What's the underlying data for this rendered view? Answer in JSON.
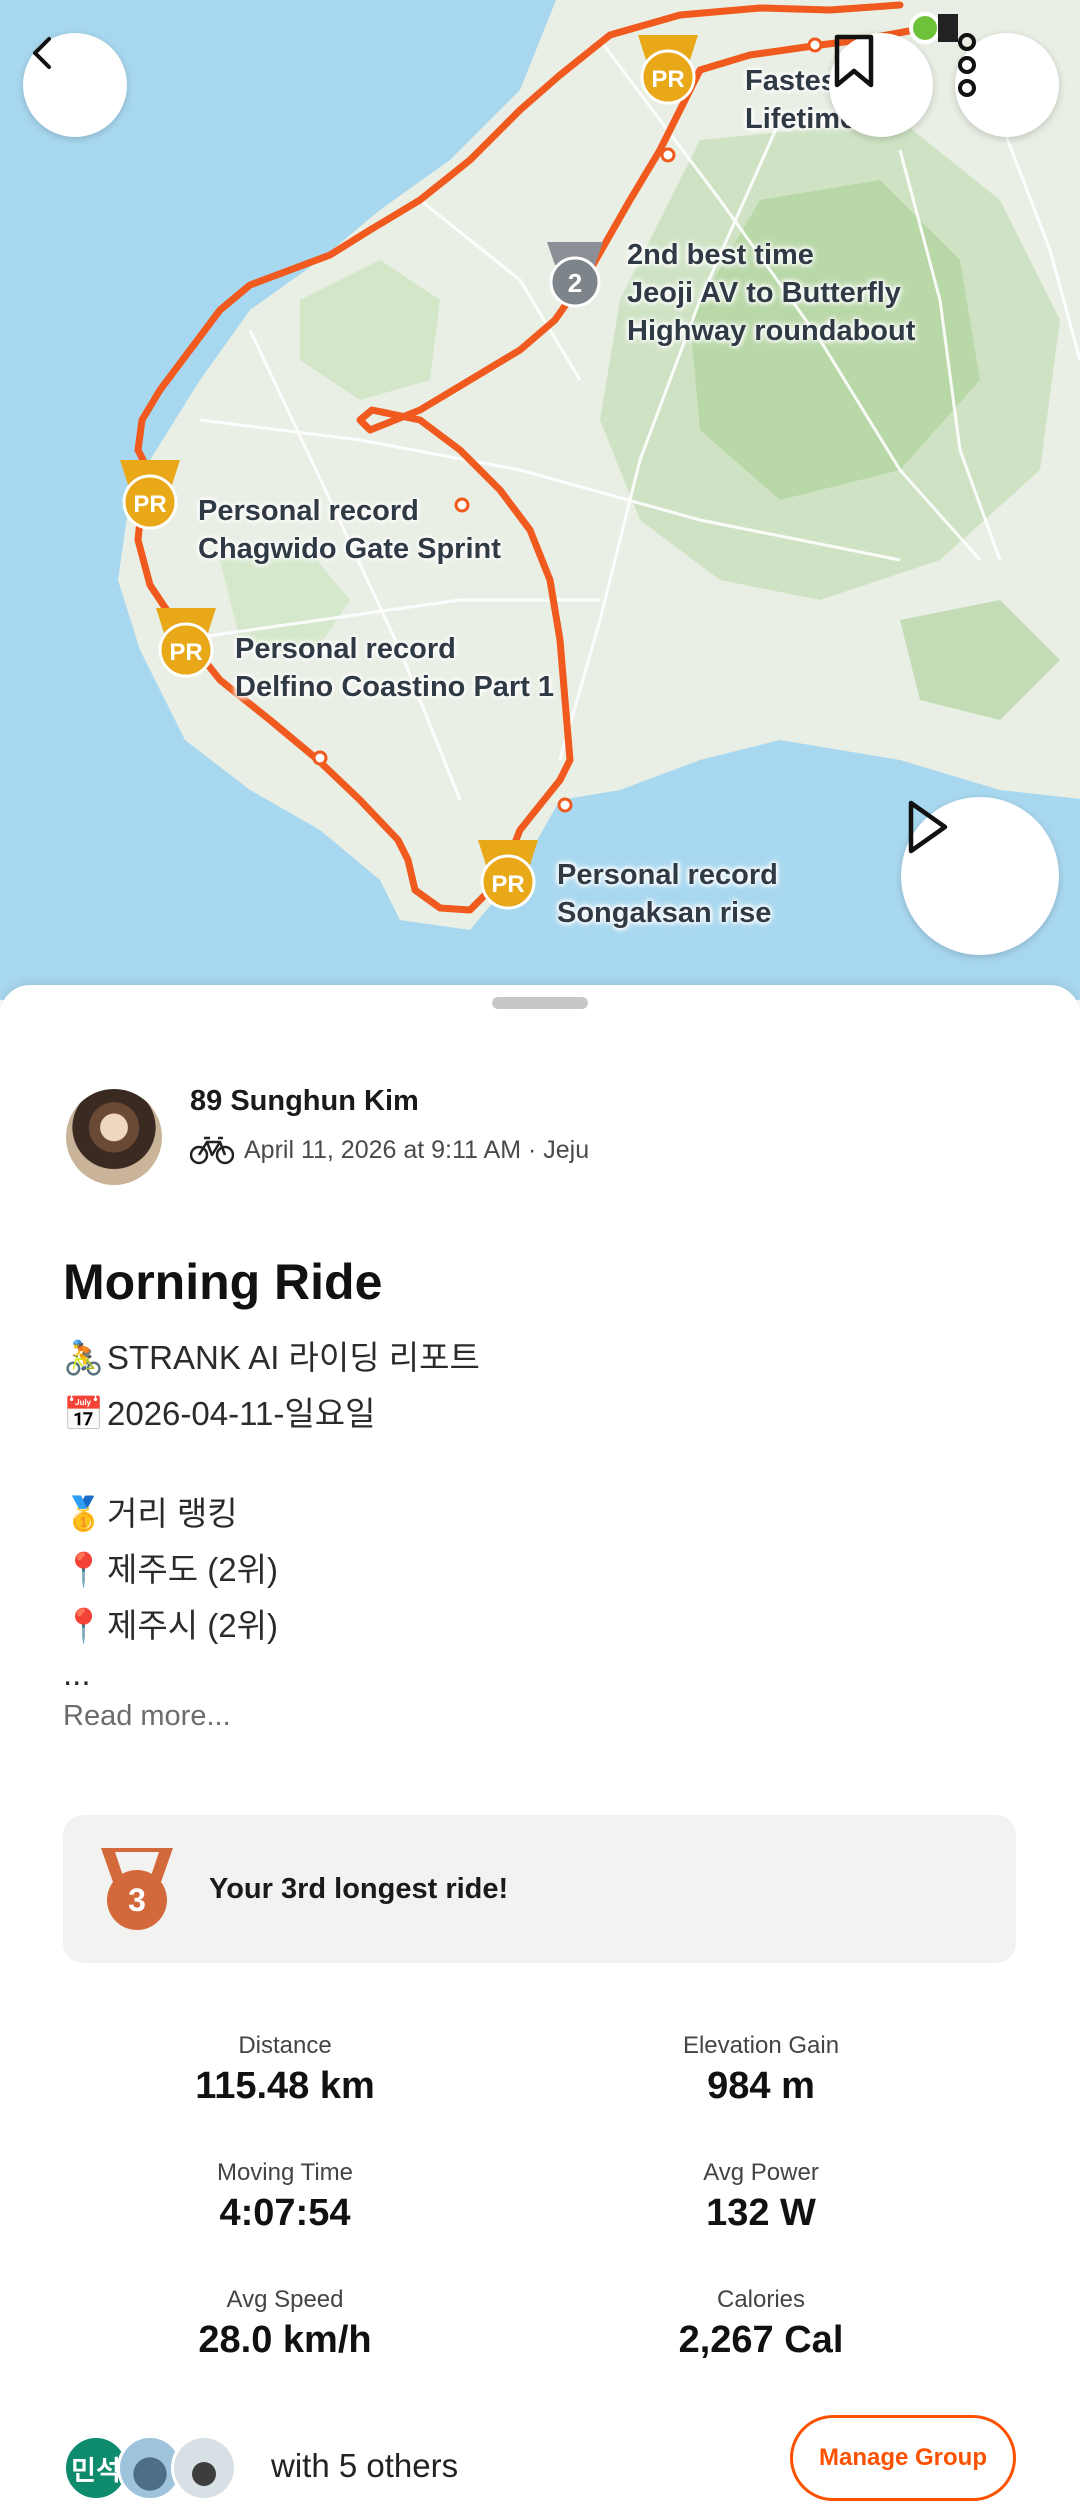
{
  "map": {
    "segments": [
      {
        "line1": "Fastest",
        "line2": "Lifetime"
      },
      {
        "line1": "2nd best time",
        "line2": "Jeoji AV to Butterfly",
        "line3": "Highway roundabout"
      },
      {
        "line1": "Personal record",
        "line2": "Chagwido Gate Sprint"
      },
      {
        "line1": "Personal record",
        "line2": "Delfino Coastino Part 1"
      },
      {
        "line1": "Personal record",
        "line2": "Songaksan rise"
      }
    ],
    "badges": {
      "pr": "PR",
      "second": "2"
    },
    "buttons": {
      "back": "back-icon",
      "bookmark": "bookmark-icon",
      "more": "more-vertical-icon",
      "play": "play-icon"
    }
  },
  "activity": {
    "athlete": "89 Sunghun Kim",
    "meta": "April 11, 2026 at 9:11 AM · Jeju",
    "sport_icon": "bike-icon",
    "title": "Morning Ride",
    "description": {
      "line1_emoji": "🚴",
      "line1": "STRANK AI 라이딩 리포트",
      "line2_emoji": "📅",
      "line2": "2026-04-11-일요일",
      "line3_emoji": "🥇",
      "line3": "거리 랭킹",
      "line4_emoji": "📍",
      "line4": "제주도 (2위)",
      "line5_emoji": "📍",
      "line5": "제주시 (2위)",
      "line6": "..."
    },
    "read_more": "Read more...",
    "achievement": {
      "medal": "3",
      "text": "Your 3rd longest ride!"
    },
    "stats": [
      {
        "label": "Distance",
        "value": "115.48 km"
      },
      {
        "label": "Elevation Gain",
        "value": "984 m"
      },
      {
        "label": "Moving Time",
        "value": "4:07:54"
      },
      {
        "label": "Avg Power",
        "value": "132 W"
      },
      {
        "label": "Avg Speed",
        "value": "28.0 km/h"
      },
      {
        "label": "Calories",
        "value": "2,267 Cal"
      }
    ],
    "group": {
      "avatar_initials": "민석",
      "with_text": "with 5 others",
      "manage_label": "Manage Group"
    }
  },
  "colors": {
    "brand": "#fc5200",
    "route": "#f05a1e",
    "pr_gold": "#e9a817",
    "water": "#a8d8f0",
    "land": "#e6efe1"
  }
}
